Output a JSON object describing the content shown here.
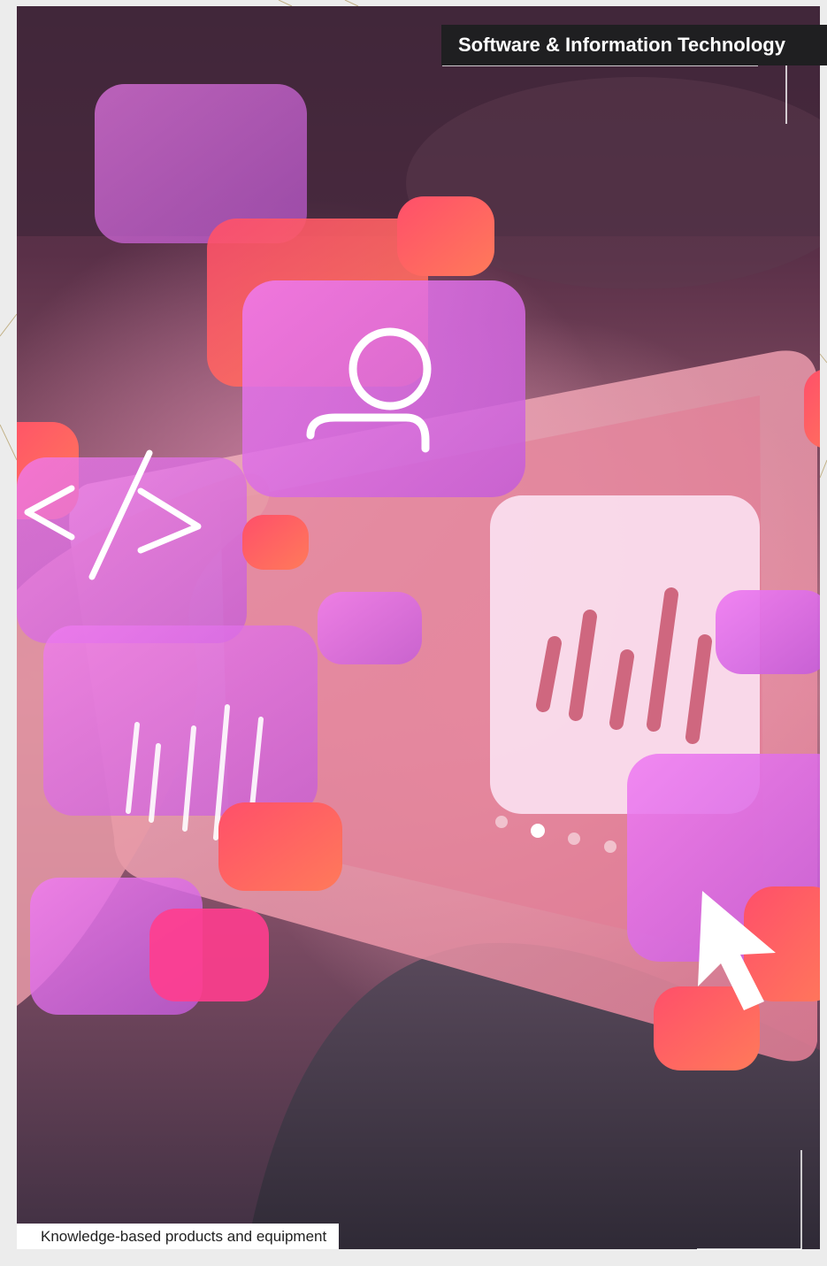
{
  "header": {
    "category_label": "Software & Information Technology"
  },
  "footer": {
    "caption": "Knowledge-based products and equipment"
  },
  "image": {
    "subject": "hand-holding-tablet-with-floating-app-icons",
    "icons": [
      "user-icon",
      "code-icon",
      "bar-chart-icon",
      "cursor-icon"
    ]
  },
  "colors": {
    "accent_magenta": "#e96ff0",
    "accent_red": "#ff3d5a",
    "tag_background": "#1f1f21",
    "page_background": "#ececec"
  }
}
